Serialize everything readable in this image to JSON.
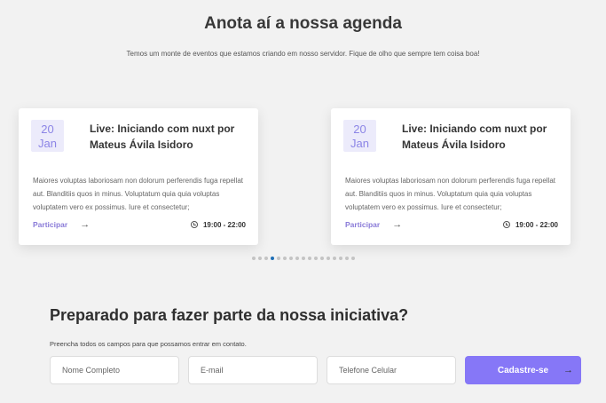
{
  "agenda": {
    "title": "Anota aí a nossa agenda",
    "subtitle": "Temos um monte de eventos que estamos criando em nosso servidor. Fique de olho que sempre tem coisa boa!"
  },
  "events": [
    {
      "day": "20",
      "month": "Jan",
      "title": "Live: Iniciando com nuxt por Mateus Ávila Isidoro",
      "description": "Maiores voluptas laboriosam non dolorum perferendis fuga repellat aut. Blanditiis quos in minus. Voluptatum quia quia voluptas voluptatem vero ex possimus. Iure et consectetur;",
      "action": "Participar",
      "time": "19:00 - 22:00"
    },
    {
      "day": "20",
      "month": "Jan",
      "title": "Live: Iniciando com nuxt por Mateus Ávila Isidoro",
      "description": "Maiores voluptas laboriosam non dolorum perferendis fuga repellat aut. Blanditiis quos in minus. Voluptatum quia quia voluptas voluptatem vero ex possimus. Iure et consectetur;",
      "action": "Participar",
      "time": "19:00 - 22:00"
    }
  ],
  "carousel": {
    "total_dots": 17,
    "active_index": 3
  },
  "signup": {
    "title": "Preparado para fazer parte da nossa iniciativa?",
    "subtitle": "Preencha todos os campos para que possamos entrar em contato.",
    "name_placeholder": "Nome Completo",
    "email_placeholder": "E-mail",
    "phone_placeholder": "Telefone Celular",
    "submit_label": "Cadastre-se"
  },
  "icons": {
    "arrow": "arrow-right-icon",
    "clock": "clock-icon"
  },
  "colors": {
    "accent": "#8677f7",
    "date_badge_bg": "#ecebfb",
    "active_dot": "#1f6fb6"
  }
}
